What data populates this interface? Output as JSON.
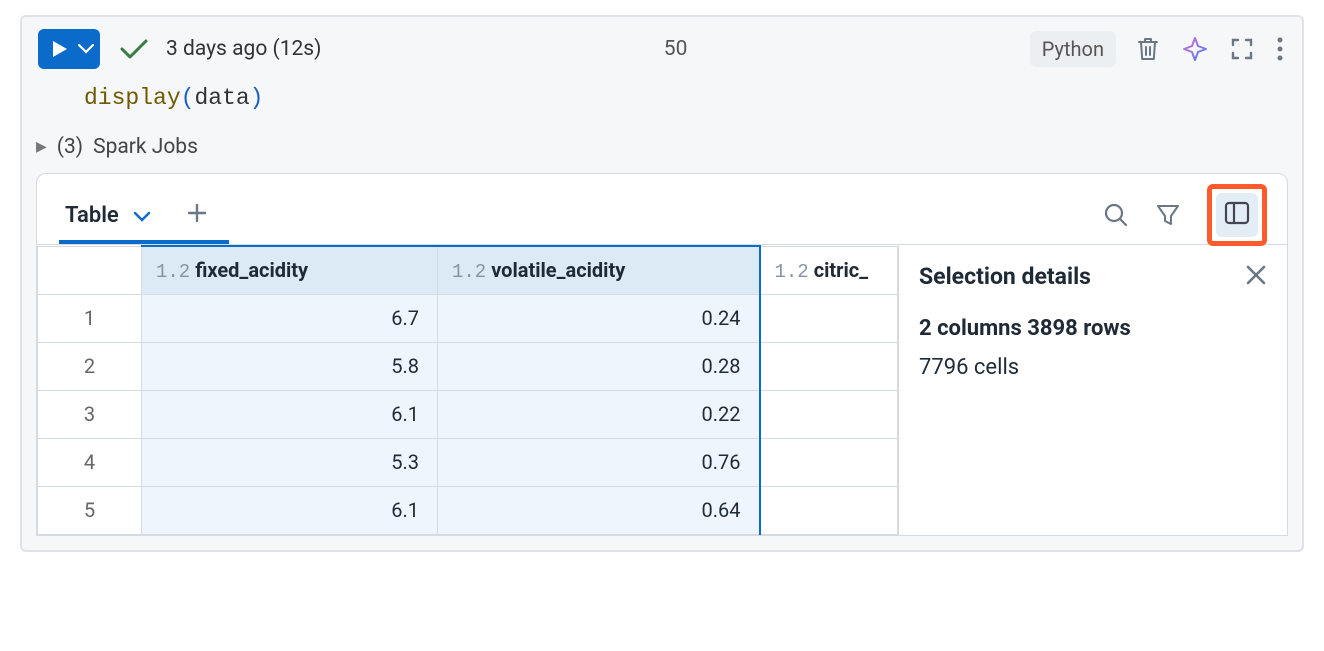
{
  "toolbar": {
    "status_text": "3 days ago (12s)",
    "center_number": "50",
    "language": "Python"
  },
  "code": {
    "fn": "display",
    "var": "data"
  },
  "spark": {
    "count": "(3)",
    "label": "Spark Jobs"
  },
  "tabs": {
    "active": "Table"
  },
  "columns": [
    {
      "type": "1.2",
      "name": "fixed_acidity"
    },
    {
      "type": "1.2",
      "name": "volatile_acidity"
    },
    {
      "type": "1.2",
      "name": "citric_"
    }
  ],
  "rows": [
    "1",
    "2",
    "3",
    "4",
    "5"
  ],
  "chart_data": {
    "type": "table",
    "columns": [
      "fixed_acidity",
      "volatile_acidity"
    ],
    "data": [
      [
        6.7,
        0.24
      ],
      [
        5.8,
        0.28
      ],
      [
        6.1,
        0.22
      ],
      [
        5.3,
        0.76
      ],
      [
        6.1,
        0.64
      ]
    ]
  },
  "details": {
    "title": "Selection details",
    "line1": "2 columns 3898 rows",
    "line2": "7796 cells"
  }
}
